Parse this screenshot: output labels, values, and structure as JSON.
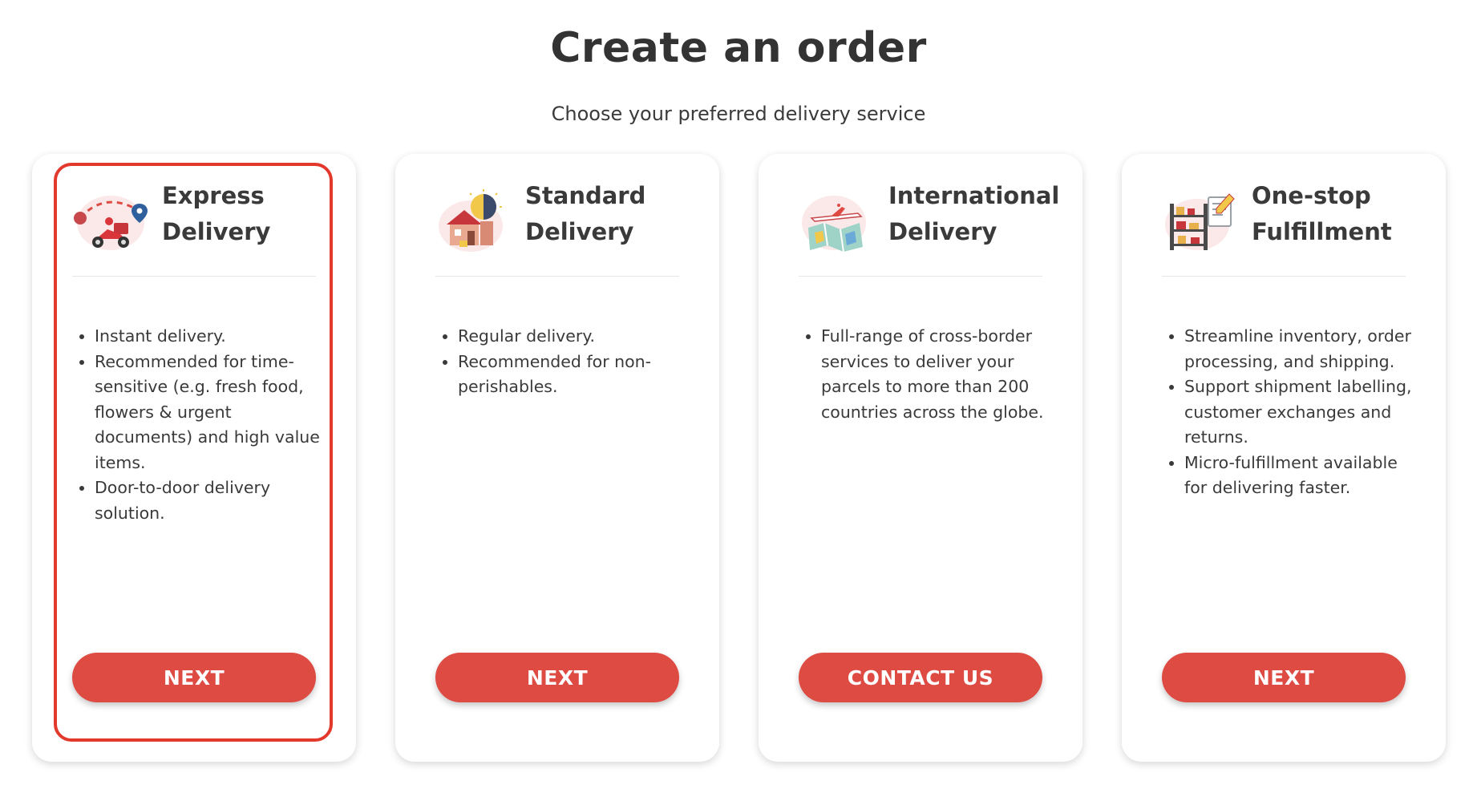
{
  "page": {
    "title": "Create an order",
    "subtitle": "Choose your preferred delivery service"
  },
  "theme": {
    "accent": "#dd4b43",
    "selected_border": "#e3392d",
    "text": "#3a3a3a"
  },
  "cards": [
    {
      "title": "Express\nDelivery",
      "icon": "scooter-route-icon",
      "selected": true,
      "bullets": [
        "Instant delivery.",
        "Recommended for time-sensitive (e.g. fresh food, flowers & urgent documents) and high value items.",
        "Door-to-door delivery solution."
      ],
      "button": "NEXT"
    },
    {
      "title": "Standard\nDelivery",
      "icon": "house-day-night-icon",
      "selected": false,
      "bullets": [
        "Regular delivery.",
        "Recommended for non-perishables."
      ],
      "button": "NEXT"
    },
    {
      "title": "International\nDelivery",
      "icon": "plane-map-icon",
      "selected": false,
      "bullets": [
        "Full-range of cross-border services to deliver your parcels to more than 200 countries across the globe."
      ],
      "button": "CONTACT US"
    },
    {
      "title": "One-stop\nFulfillment",
      "icon": "warehouse-shelves-icon",
      "selected": false,
      "bullets": [
        "Streamline inventory, order processing, and shipping.",
        "Support shipment labelling, customer exchanges and returns.",
        "Micro-fulfillment available for delivering faster."
      ],
      "button": "NEXT"
    }
  ]
}
